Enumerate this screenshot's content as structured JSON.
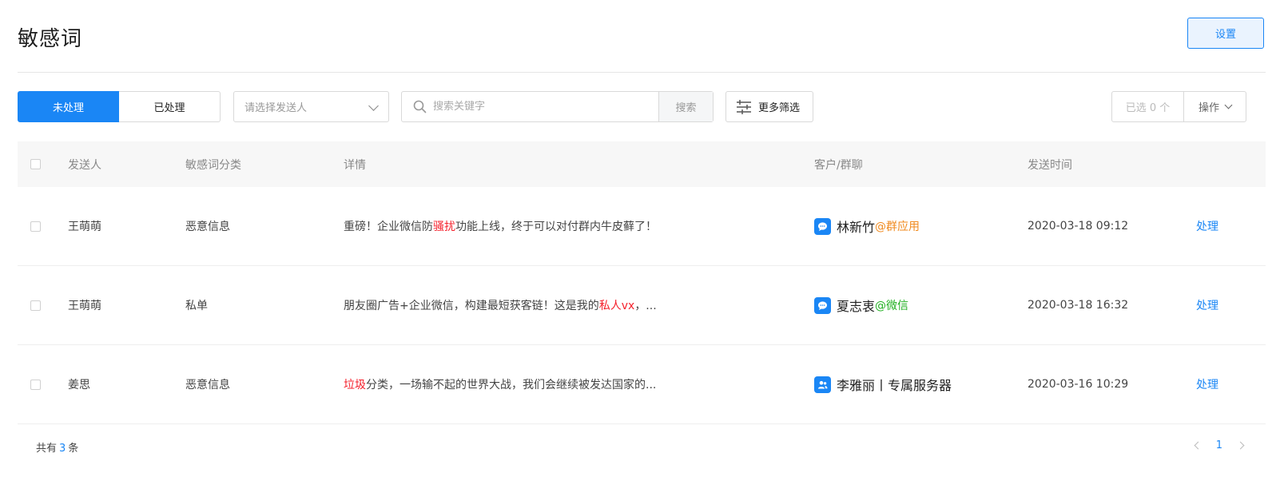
{
  "header": {
    "title": "敏感词",
    "settings_label": "设置"
  },
  "toolbar": {
    "tabs": [
      {
        "label": "未处理",
        "active": true
      },
      {
        "label": "已处理",
        "active": false
      }
    ],
    "sender_select_placeholder": "请选择发送人",
    "search_placeholder": "搜索关键字",
    "search_button": "搜索",
    "more_filters": "更多筛选",
    "selected_count": "已选 0 个",
    "operations": "操作"
  },
  "table": {
    "columns": [
      "发送人",
      "敏感词分类",
      "详情",
      "客户/群聊",
      "发送时间"
    ],
    "rows": [
      {
        "sender": "王萌萌",
        "category": "恶意信息",
        "detail_before": "重磅！企业微信防",
        "detail_keyword": "骚扰",
        "detail_after": "功能上线，终于可以对付群内牛皮藓了！",
        "customer_icon": "chat-bubble-icon",
        "customer_name": "林新竹",
        "customer_tag": "@群应用",
        "time": "2020-03-18  09:12",
        "action": "处理"
      },
      {
        "sender": "王萌萌",
        "category": "私单",
        "detail_before": "朋友圈广告+企业微信，构建最短获客链！这是我的",
        "detail_keyword": "私人vx",
        "detail_after": "，...",
        "customer_icon": "chat-bubble-icon",
        "customer_name": "夏志衷",
        "customer_tag": "@微信",
        "time": "2020-03-18  16:32",
        "action": "处理"
      },
      {
        "sender": "姜思",
        "category": "恶意信息",
        "detail_before": "",
        "detail_keyword": "垃圾",
        "detail_after": "分类，一场输不起的世界大战，我们会继续被发达国家的...",
        "customer_icon": "group-chat-icon",
        "customer_name": "李雅丽丨专属服务器",
        "customer_tag": "",
        "time": "2020-03-16  10:29",
        "action": "处理"
      }
    ]
  },
  "footer": {
    "total_prefix": "共有",
    "total_count": "3",
    "total_suffix": "条",
    "current_page": "1"
  },
  "colors": {
    "primary": "#1a86f5",
    "keyword_highlight": "#f5222d",
    "tag_group_app": "#f08a1e",
    "tag_wechat": "#22b022"
  }
}
